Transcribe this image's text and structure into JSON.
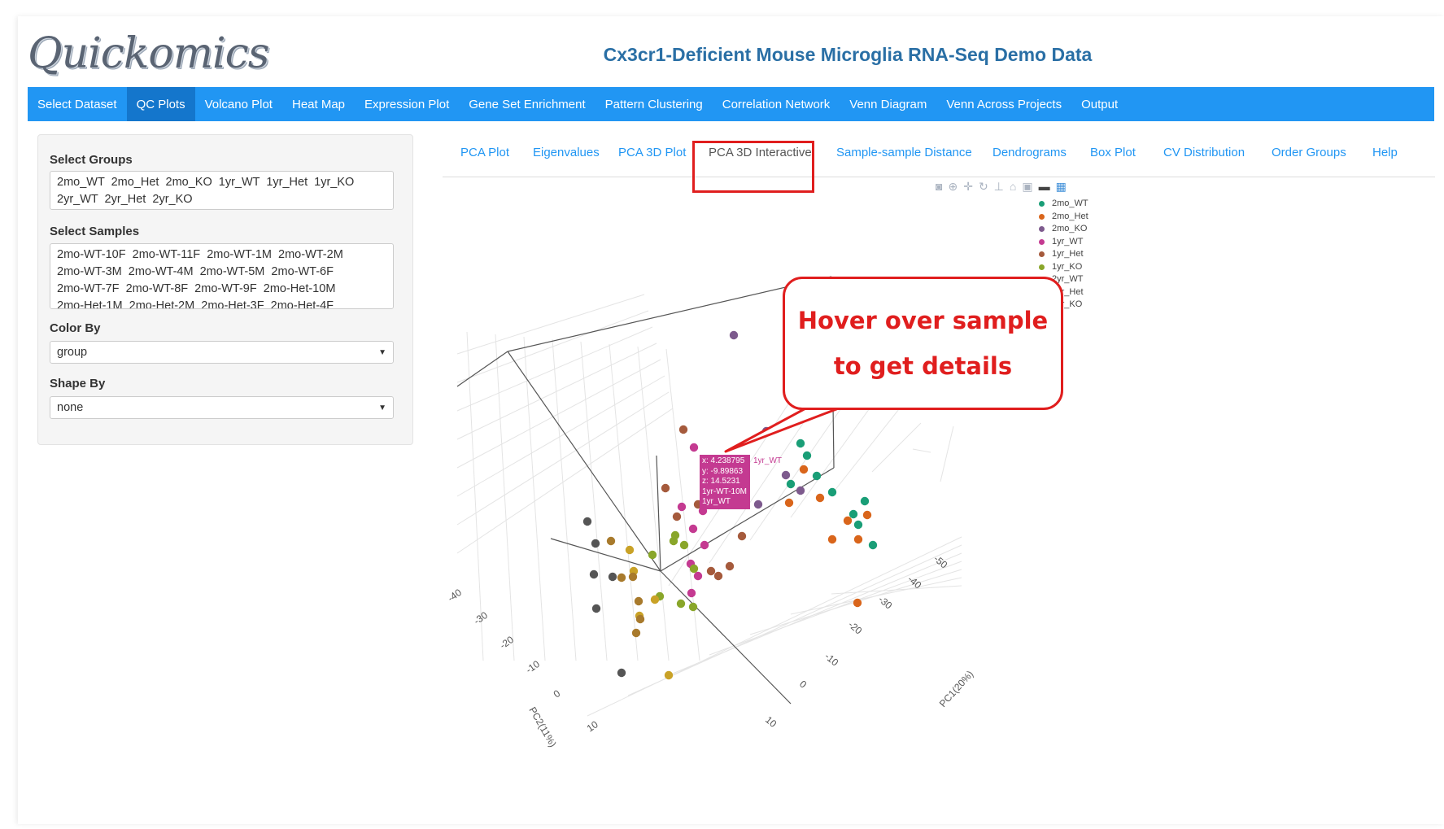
{
  "app": {
    "logo_text": "Quickomics",
    "title": "Cx3cr1-Deficient Mouse Microglia RNA-Seq Demo Data"
  },
  "navbar": {
    "items": [
      "Select Dataset",
      "QC Plots",
      "Volcano Plot",
      "Heat Map",
      "Expression Plot",
      "Gene Set Enrichment",
      "Pattern Clustering",
      "Correlation Network",
      "Venn Diagram",
      "Venn Across Projects",
      "Output"
    ],
    "active": "QC Plots"
  },
  "sidebar": {
    "groups_label": "Select Groups",
    "groups_line1": "2mo_WT  2mo_Het  2mo_KO  1yr_WT  1yr_Het  1yr_KO",
    "groups_line2": "2yr_WT  2yr_Het  2yr_KO",
    "samples_label": "Select Samples",
    "samples_line1": "2mo-WT-10F  2mo-WT-11F  2mo-WT-1M  2mo-WT-2M",
    "samples_line2": "2mo-WT-3M  2mo-WT-4M  2mo-WT-5M  2mo-WT-6F",
    "samples_line3": "2mo-WT-7F  2mo-WT-8F  2mo-WT-9F  2mo-Het-10M",
    "samples_line4": "2mo-Het-1M  2mo-Het-2M  2mo-Het-3F  2mo-Het-4F",
    "color_by_label": "Color By",
    "color_by_value": "group",
    "shape_by_label": "Shape By",
    "shape_by_value": "none"
  },
  "tabs": {
    "items": [
      "PCA Plot",
      "Eigenvalues",
      "PCA 3D Plot",
      "PCA 3D Interactive",
      "Sample-sample Distance",
      "Dendrograms",
      "Box Plot",
      "CV Distribution",
      "Order Groups",
      "Help"
    ],
    "active": "PCA 3D Interactive"
  },
  "modebar": {
    "icons": [
      "camera-icon",
      "zoom-icon",
      "pan-icon",
      "orbit-icon",
      "turntable-icon",
      "home-icon",
      "reset-camera-icon",
      "hover-icon",
      "plotly-logo-icon"
    ]
  },
  "legend": {
    "entries": [
      {
        "name": "2mo_WT",
        "color": "#1a9e77"
      },
      {
        "name": "2mo_Het",
        "color": "#d9651b"
      },
      {
        "name": "2mo_KO",
        "color": "#7d5a8d"
      },
      {
        "name": "1yr_WT",
        "color": "#c43a91"
      },
      {
        "name": "1yr_Het",
        "color": "#a55a3c"
      },
      {
        "name": "1yr_KO",
        "color": "#89a62a"
      },
      {
        "name": "2yr_WT",
        "color": "#c9a227"
      },
      {
        "name": "2yr_Het",
        "color": "#a87a2c"
      },
      {
        "name": "2yr_KO",
        "color": "#555555"
      }
    ]
  },
  "tooltip": {
    "x": "x: 4.238795",
    "y": "y: -9.89863",
    "z": "z: 14.5231",
    "sample": "1yr-WT-10M",
    "group_text": "1yr_WT",
    "group_side": "1yr_WT"
  },
  "callout": {
    "line1": "Hover over sample",
    "line2": "to get details"
  },
  "axes": {
    "pc1_label": "PC1(20%)",
    "pc2_label": "PC2(11%)",
    "pc2_ticks": [
      "-40",
      "-30",
      "-20",
      "-10",
      "0",
      "10"
    ],
    "pc1_ticks": [
      "-50",
      "-40",
      "-30",
      "-20",
      "-10",
      "0",
      "10"
    ]
  },
  "chart_data": {
    "type": "scatter",
    "xlabel": "PC1(20%)",
    "ylabel": "PC2(11%)",
    "series": [
      {
        "name": "2mo_WT",
        "points": [
          [
            15,
            -20
          ],
          [
            16,
            -18
          ],
          [
            22,
            -13
          ],
          [
            17,
            -15
          ],
          [
            14,
            -13
          ],
          [
            20,
            -9
          ],
          [
            22,
            -7
          ],
          [
            19,
            -11
          ],
          [
            18,
            -5
          ]
        ]
      },
      {
        "name": "2mo_Het",
        "points": [
          [
            16,
            -17
          ],
          [
            14,
            -14
          ],
          [
            19,
            -15
          ],
          [
            20,
            -12
          ],
          [
            21,
            -6
          ],
          [
            18,
            -10
          ],
          [
            21,
            -13
          ],
          [
            20,
            -1
          ]
        ]
      },
      {
        "name": "2mo_KO",
        "points": [
          [
            9,
            -24
          ],
          [
            13,
            -14
          ],
          [
            16,
            -14
          ],
          [
            12,
            -18
          ],
          [
            6,
            -31
          ],
          [
            17,
            -8
          ]
        ]
      },
      {
        "name": "1yr_WT",
        "points": [
          [
            4.24,
            -9.9
          ],
          [
            3,
            -14
          ],
          [
            4,
            -9
          ],
          [
            2,
            -7
          ],
          [
            5,
            -4
          ],
          [
            4,
            -1
          ],
          [
            3,
            -2
          ],
          [
            5,
            -11
          ]
        ]
      },
      {
        "name": "1yr_Het",
        "points": [
          [
            4,
            -15
          ],
          [
            3,
            -8
          ],
          [
            5,
            -8
          ],
          [
            6,
            -3
          ],
          [
            7,
            -2
          ],
          [
            8,
            -5
          ],
          [
            6,
            -1
          ],
          [
            3,
            -12
          ]
        ]
      },
      {
        "name": "1yr_KO",
        "points": [
          [
            2,
            -11
          ],
          [
            3,
            -8
          ],
          [
            4,
            -10
          ],
          [
            5,
            -6
          ],
          [
            4,
            -2
          ],
          [
            3,
            0
          ],
          [
            2,
            -12
          ],
          [
            1,
            -9
          ]
        ]
      },
      {
        "name": "2yr_WT",
        "points": [
          [
            -2,
            -7
          ],
          [
            -1,
            -4
          ],
          [
            -3,
            -1
          ],
          [
            -1,
            0
          ],
          [
            0,
            4
          ]
        ]
      },
      {
        "name": "2yr_Het",
        "points": [
          [
            -3,
            -6
          ],
          [
            -2,
            -3
          ],
          [
            -4,
            -2
          ],
          [
            -3,
            2
          ],
          [
            -2,
            3
          ],
          [
            -1,
            1
          ]
        ]
      },
      {
        "name": "2yr_KO",
        "points": [
          [
            -5,
            -12
          ],
          [
            -4,
            -9
          ],
          [
            -3,
            -7
          ],
          [
            -5,
            -5
          ],
          [
            -4,
            -2
          ],
          [
            -3,
            -1
          ]
        ]
      }
    ]
  }
}
